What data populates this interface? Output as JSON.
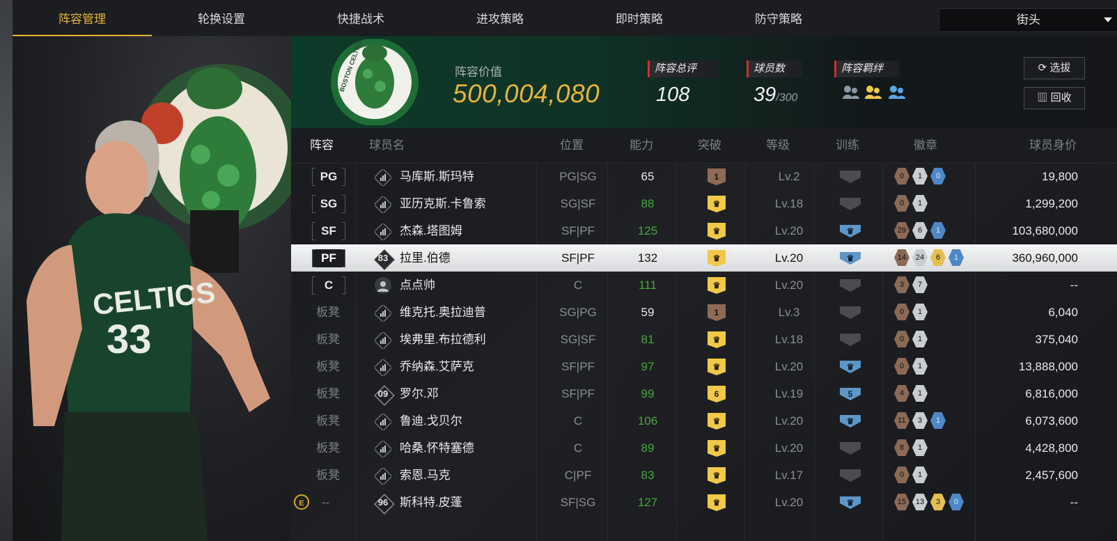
{
  "nav": {
    "tabs": [
      "阵容管理",
      "轮换设置",
      "快捷战术",
      "进攻策略",
      "即时策略",
      "防守策略"
    ],
    "active_tab": 0,
    "mode_select": "街头"
  },
  "team": {
    "value_label": "阵容价值",
    "value": "500,004,080",
    "overall_label": "阵容总评",
    "overall": "108",
    "player_count_label": "球员数",
    "player_count": "39",
    "player_capacity": "/300",
    "bonds_label": "阵容羁绊",
    "bonds": [
      "gray-bond-icon",
      "gold-bond-icon",
      "blue-bond-icon"
    ],
    "select_label": "选拔",
    "recycle_label": "回收",
    "logo_text": "BOSTON CELTICS"
  },
  "player_art": {
    "jersey_text": "CELTICS",
    "jersey_number": "33"
  },
  "table": {
    "headers": [
      "阵容",
      "球员名",
      "位置",
      "能力",
      "突破",
      "等级",
      "训练",
      "徽章",
      "球员身价"
    ],
    "rows": [
      {
        "slot": "PG",
        "grade": "",
        "name": "马库斯.斯玛特",
        "pos": "PG|SG",
        "ovr": "65",
        "ovr_green": false,
        "brk": "1",
        "brk_type": "brown",
        "lvl": "Lv.2",
        "train": "",
        "train_type": "gray",
        "badges": [
          [
            "0",
            "b0"
          ],
          [
            "1",
            "b1"
          ],
          [
            "0",
            "b3"
          ]
        ],
        "value": "19,800"
      },
      {
        "slot": "SG",
        "grade": "",
        "name": "亚历克斯.卡鲁索",
        "pos": "SG|SF",
        "ovr": "88",
        "ovr_green": true,
        "brk": "♛",
        "brk_type": "crown",
        "lvl": "Lv.18",
        "train": "",
        "train_type": "gray",
        "badges": [
          [
            "0",
            "b0"
          ],
          [
            "1",
            "b1"
          ]
        ],
        "value": "1,299,200"
      },
      {
        "slot": "SF",
        "grade": "",
        "name": "杰森.塔图姆",
        "pos": "SF|PF",
        "ovr": "125",
        "ovr_green": true,
        "brk": "♛",
        "brk_type": "crown",
        "lvl": "Lv.20",
        "train": "♛",
        "train_type": "blue",
        "badges": [
          [
            "29",
            "b0"
          ],
          [
            "6",
            "b1"
          ],
          [
            "1",
            "b3"
          ]
        ],
        "value": "103,680,000"
      },
      {
        "slot": "PF",
        "grade": "83",
        "name": "拉里.伯德",
        "pos": "SF|PF",
        "ovr": "132",
        "ovr_green": false,
        "brk": "♛",
        "brk_type": "crown",
        "lvl": "Lv.20",
        "train": "♛",
        "train_type": "blue",
        "badges": [
          [
            "14",
            "b0"
          ],
          [
            "24",
            "b1"
          ],
          [
            "6",
            "b2"
          ],
          [
            "1",
            "b3"
          ]
        ],
        "value": "360,960,000",
        "selected": true
      },
      {
        "slot": "C",
        "grade": "",
        "name": "点点帅",
        "pos": "C",
        "ovr": "111",
        "ovr_green": true,
        "brk": "♛",
        "brk_type": "crown",
        "lvl": "Lv.20",
        "train": "",
        "train_type": "gray",
        "badges": [
          [
            "3",
            "b0"
          ],
          [
            "7",
            "b1"
          ]
        ],
        "value": "--",
        "avatar": true
      },
      {
        "slot": "板凳",
        "grade": "",
        "name": "维克托.奥拉迪普",
        "pos": "SG|PG",
        "ovr": "59",
        "ovr_green": false,
        "brk": "1",
        "brk_type": "brown",
        "lvl": "Lv.3",
        "train": "",
        "train_type": "gray",
        "badges": [
          [
            "0",
            "b0"
          ],
          [
            "1",
            "b1"
          ]
        ],
        "value": "6,040"
      },
      {
        "slot": "板凳",
        "grade": "",
        "name": "埃弗里.布拉德利",
        "pos": "SG|SF",
        "ovr": "81",
        "ovr_green": true,
        "brk": "♛",
        "brk_type": "crown",
        "lvl": "Lv.18",
        "train": "",
        "train_type": "gray",
        "badges": [
          [
            "0",
            "b0"
          ],
          [
            "1",
            "b1"
          ]
        ],
        "value": "375,040"
      },
      {
        "slot": "板凳",
        "grade": "",
        "name": "乔纳森.艾萨克",
        "pos": "SF|PF",
        "ovr": "97",
        "ovr_green": true,
        "brk": "♛",
        "brk_type": "crown",
        "lvl": "Lv.20",
        "train": "♛",
        "train_type": "blue",
        "badges": [
          [
            "0",
            "b0"
          ],
          [
            "1",
            "b1"
          ]
        ],
        "value": "13,888,000"
      },
      {
        "slot": "板凳",
        "grade": "09",
        "name": "罗尔.邓",
        "pos": "SF|PF",
        "ovr": "99",
        "ovr_green": true,
        "brk": "6",
        "brk_type": "gold6",
        "lvl": "Lv.19",
        "train": "5",
        "train_type": "blue",
        "badges": [
          [
            "4",
            "b0"
          ],
          [
            "1",
            "b1"
          ]
        ],
        "value": "6,816,000"
      },
      {
        "slot": "板凳",
        "grade": "",
        "name": "鲁迪.戈贝尔",
        "pos": "C",
        "ovr": "106",
        "ovr_green": true,
        "brk": "♛",
        "brk_type": "crown",
        "lvl": "Lv.20",
        "train": "♛",
        "train_type": "blue",
        "badges": [
          [
            "11",
            "b0"
          ],
          [
            "3",
            "b1"
          ],
          [
            "1",
            "b3"
          ]
        ],
        "value": "6,073,600"
      },
      {
        "slot": "板凳",
        "grade": "",
        "name": "哈桑.怀特塞德",
        "pos": "C",
        "ovr": "89",
        "ovr_green": true,
        "brk": "♛",
        "brk_type": "crown",
        "lvl": "Lv.20",
        "train": "",
        "train_type": "gray",
        "badges": [
          [
            "8",
            "b0"
          ],
          [
            "1",
            "b1"
          ]
        ],
        "value": "4,428,800"
      },
      {
        "slot": "板凳",
        "grade": "",
        "name": "索恩.马克",
        "pos": "C|PF",
        "ovr": "83",
        "ovr_green": true,
        "brk": "♛",
        "brk_type": "crown",
        "lvl": "Lv.17",
        "train": "",
        "train_type": "gray",
        "badges": [
          [
            "0",
            "b0"
          ],
          [
            "1",
            "b1"
          ]
        ],
        "value": "2,457,600"
      },
      {
        "slot": "--",
        "grade": "96",
        "name": "斯科特.皮蓬",
        "pos": "SF|SG",
        "ovr": "127",
        "ovr_green": true,
        "brk": "♛",
        "brk_type": "crown",
        "lvl": "Lv.20",
        "train": "♛",
        "train_type": "blue",
        "badges": [
          [
            "15",
            "b0"
          ],
          [
            "13",
            "b1"
          ],
          [
            "3",
            "b2"
          ],
          [
            "0",
            "b3"
          ]
        ],
        "value": "--",
        "flag": "E"
      }
    ]
  }
}
